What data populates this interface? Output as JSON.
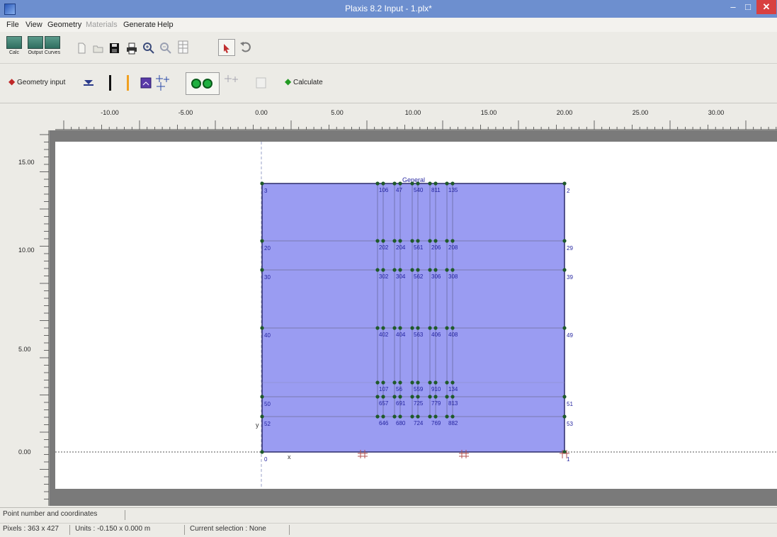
{
  "window": {
    "title": "Plaxis 8.2 Input - 1.plx*",
    "minimize": "–",
    "maximize": "□",
    "close": "✕"
  },
  "menu": [
    {
      "label": "File",
      "enabled": true
    },
    {
      "label": "View",
      "enabled": true
    },
    {
      "label": "Geometry",
      "enabled": true
    },
    {
      "label": "Materials",
      "enabled": false
    },
    {
      "label": "Generate",
      "enabled": true
    },
    {
      "label": "Help",
      "enabled": true
    }
  ],
  "toolbar": {
    "programs": [
      "Calc",
      "Output",
      "Curves"
    ],
    "geometry_input": "Geometry input",
    "calculate": "Calculate"
  },
  "rulers": {
    "x_labels": [
      "-10.00",
      "-5.00",
      "0.00",
      "5.00",
      "10.00",
      "15.00",
      "20.00",
      "25.00",
      "30.00"
    ],
    "y_labels": [
      "15.00",
      "10.00",
      "5.00",
      "0.00"
    ]
  },
  "model": {
    "fill": "#9a9cf2",
    "outline": "#2c2c6a",
    "label_color": "#2424a0",
    "general_label": "General",
    "left_labels": [
      "3",
      "20",
      "30",
      "40",
      "50",
      "52"
    ],
    "right_labels": [
      "2",
      "29",
      "39",
      "49",
      "51",
      "53"
    ],
    "corner_labels": [
      "0",
      "1"
    ],
    "inner_rows": [
      [
        "106",
        "47",
        "540",
        "811",
        "135"
      ],
      [
        "202",
        "204",
        "561",
        "206",
        "208"
      ],
      [
        "302",
        "304",
        "562",
        "306",
        "308"
      ],
      [
        "402",
        "404",
        "563",
        "406",
        "408"
      ],
      [
        "107",
        "56",
        "559",
        "910",
        "134"
      ],
      [
        "657",
        "691",
        "725",
        "779",
        "813"
      ],
      [
        "646",
        "680",
        "724",
        "769",
        "882"
      ]
    ],
    "axis_x": "x",
    "axis_y": "y"
  },
  "status": {
    "hint": "Point number and coordinates",
    "pixels": "Pixels : 363 x 427",
    "units": "Units : -0.150 x 0.000 m",
    "selection": "Current selection : None"
  }
}
